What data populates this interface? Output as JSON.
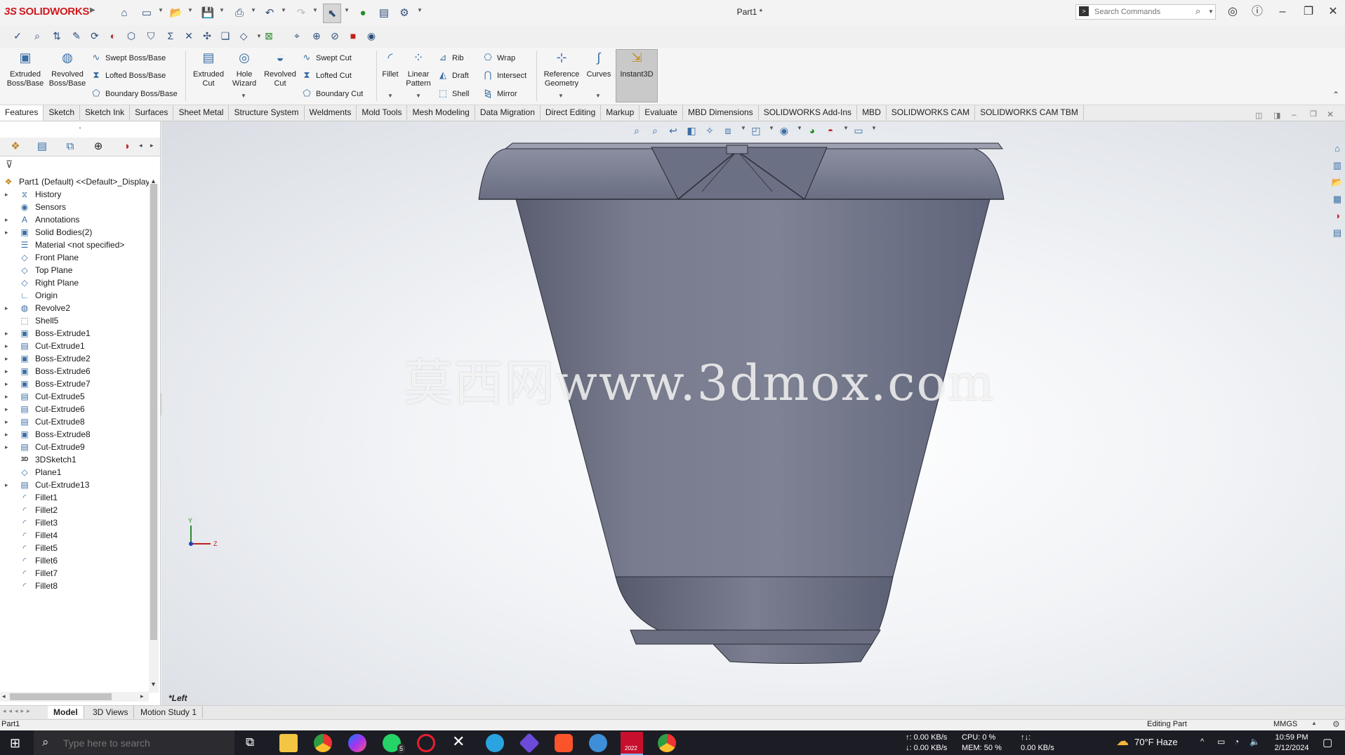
{
  "app": {
    "name": "SOLIDWORKS",
    "logo_prefix": "3S",
    "document_title": "Part1 *"
  },
  "search": {
    "placeholder": "Search Commands"
  },
  "ribbon": {
    "extruded_boss": "Extruded Boss/Base",
    "revolved_boss": "Revolved Boss/Base",
    "swept_boss": "Swept Boss/Base",
    "lofted_boss": "Lofted Boss/Base",
    "boundary_boss": "Boundary Boss/Base",
    "extruded_cut": "Extruded Cut",
    "hole_wizard": "Hole Wizard",
    "revolved_cut": "Revolved Cut",
    "swept_cut": "Swept Cut",
    "lofted_cut": "Lofted Cut",
    "boundary_cut": "Boundary Cut",
    "fillet": "Fillet",
    "linear_pattern": "Linear Pattern",
    "rib": "Rib",
    "draft": "Draft",
    "shell": "Shell",
    "wrap": "Wrap",
    "intersect": "Intersect",
    "mirror": "Mirror",
    "reference_geometry": "Reference Geometry",
    "curves": "Curves",
    "instant3d": "Instant3D"
  },
  "tabs": [
    "Features",
    "Sketch",
    "Sketch Ink",
    "Surfaces",
    "Sheet Metal",
    "Structure System",
    "Weldments",
    "Mold Tools",
    "Mesh Modeling",
    "Data Migration",
    "Direct Editing",
    "Markup",
    "Evaluate",
    "MBD Dimensions",
    "SOLIDWORKS Add-Ins",
    "MBD",
    "SOLIDWORKS CAM",
    "SOLIDWORKS CAM TBM"
  ],
  "tree": {
    "root": "Part1 (Default) <<Default>_Display",
    "items": [
      {
        "label": "History",
        "exp": true
      },
      {
        "label": "Sensors",
        "exp": false
      },
      {
        "label": "Annotations",
        "exp": true
      },
      {
        "label": "Solid Bodies(2)",
        "exp": true
      },
      {
        "label": "Material <not specified>",
        "exp": false
      },
      {
        "label": "Front Plane",
        "exp": false
      },
      {
        "label": "Top Plane",
        "exp": false
      },
      {
        "label": "Right Plane",
        "exp": false
      },
      {
        "label": "Origin",
        "exp": false
      },
      {
        "label": "Revolve2",
        "exp": true
      },
      {
        "label": "Shell5",
        "exp": false
      },
      {
        "label": "Boss-Extrude1",
        "exp": true
      },
      {
        "label": "Cut-Extrude1",
        "exp": true
      },
      {
        "label": "Boss-Extrude2",
        "exp": true
      },
      {
        "label": "Boss-Extrude6",
        "exp": true
      },
      {
        "label": "Boss-Extrude7",
        "exp": true
      },
      {
        "label": "Cut-Extrude5",
        "exp": true
      },
      {
        "label": "Cut-Extrude6",
        "exp": true
      },
      {
        "label": "Cut-Extrude8",
        "exp": true
      },
      {
        "label": "Boss-Extrude8",
        "exp": true
      },
      {
        "label": "Cut-Extrude9",
        "exp": true
      },
      {
        "label": "3DSketch1",
        "exp": false
      },
      {
        "label": "Plane1",
        "exp": false
      },
      {
        "label": "Cut-Extrude13",
        "exp": true
      },
      {
        "label": "Fillet1",
        "exp": false
      },
      {
        "label": "Fillet2",
        "exp": false
      },
      {
        "label": "Fillet3",
        "exp": false
      },
      {
        "label": "Fillet4",
        "exp": false
      },
      {
        "label": "Fillet5",
        "exp": false
      },
      {
        "label": "Fillet6",
        "exp": false
      },
      {
        "label": "Fillet7",
        "exp": false
      },
      {
        "label": "Fillet8",
        "exp": false
      }
    ]
  },
  "viewport": {
    "view_name": "*Left",
    "watermark": "莫西网www.3dmox.com",
    "axis_y": "Y",
    "axis_z": "Z"
  },
  "bottom_tabs": [
    "Model",
    "3D Views",
    "Motion Study 1"
  ],
  "status": {
    "doc": "Part1",
    "mode": "Editing Part",
    "units": "MMGS"
  },
  "taskbar": {
    "search_placeholder": "Type here to search",
    "net_up": "↑: 0.00 KB/s",
    "net_down": "↓: 0.00 KB/s",
    "cpu": "CPU: 0 %",
    "mem": "MEM: 50 %",
    "disk_label": "↑↓:",
    "disk": "0.00 KB/s",
    "weather": "70°F  Haze",
    "time": "10:59 PM",
    "date": "2/12/2024",
    "whatsapp_badge": "5",
    "sw_badge": "2022"
  }
}
